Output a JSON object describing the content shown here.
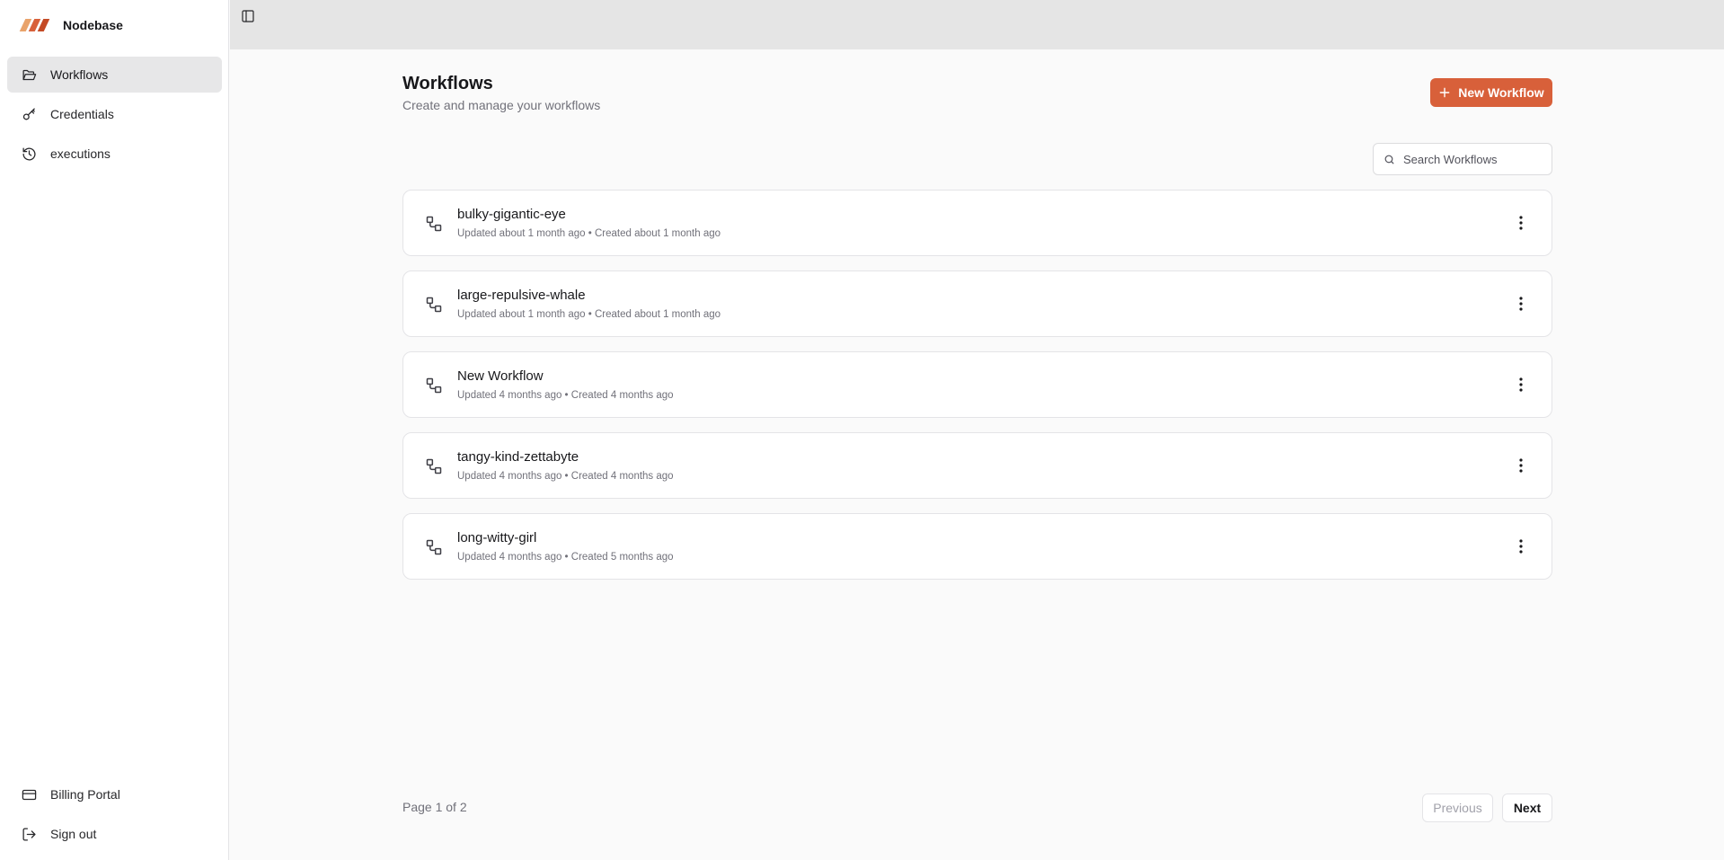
{
  "app": {
    "name": "Nodebase",
    "accent": "#d8603a"
  },
  "sidebar": {
    "items": [
      {
        "label": "Workflows",
        "icon": "folder-open-icon",
        "active": true
      },
      {
        "label": "Credentials",
        "icon": "key-icon",
        "active": false
      },
      {
        "label": "executions",
        "icon": "history-icon",
        "active": false
      }
    ],
    "bottom": [
      {
        "label": "Billing Portal",
        "icon": "credit-card-icon"
      },
      {
        "label": "Sign out",
        "icon": "log-out-icon"
      }
    ]
  },
  "header": {
    "title": "Workflows",
    "subtitle": "Create and manage your workflows",
    "new_button": "New Workflow"
  },
  "search": {
    "placeholder": "Search Workflows",
    "value": ""
  },
  "workflows": [
    {
      "name": "bulky-gigantic-eye",
      "meta": "Updated about 1 month ago • Created about 1 month ago"
    },
    {
      "name": "large-repulsive-whale",
      "meta": "Updated about 1 month ago • Created about 1 month ago"
    },
    {
      "name": "New Workflow",
      "meta": "Updated 4 months ago • Created 4 months ago"
    },
    {
      "name": "tangy-kind-zettabyte",
      "meta": "Updated 4 months ago • Created 4 months ago"
    },
    {
      "name": "long-witty-girl",
      "meta": "Updated 4 months ago • Created 5 months ago"
    }
  ],
  "pagination": {
    "info": "Page 1 of 2",
    "previous": "Previous",
    "next": "Next"
  }
}
